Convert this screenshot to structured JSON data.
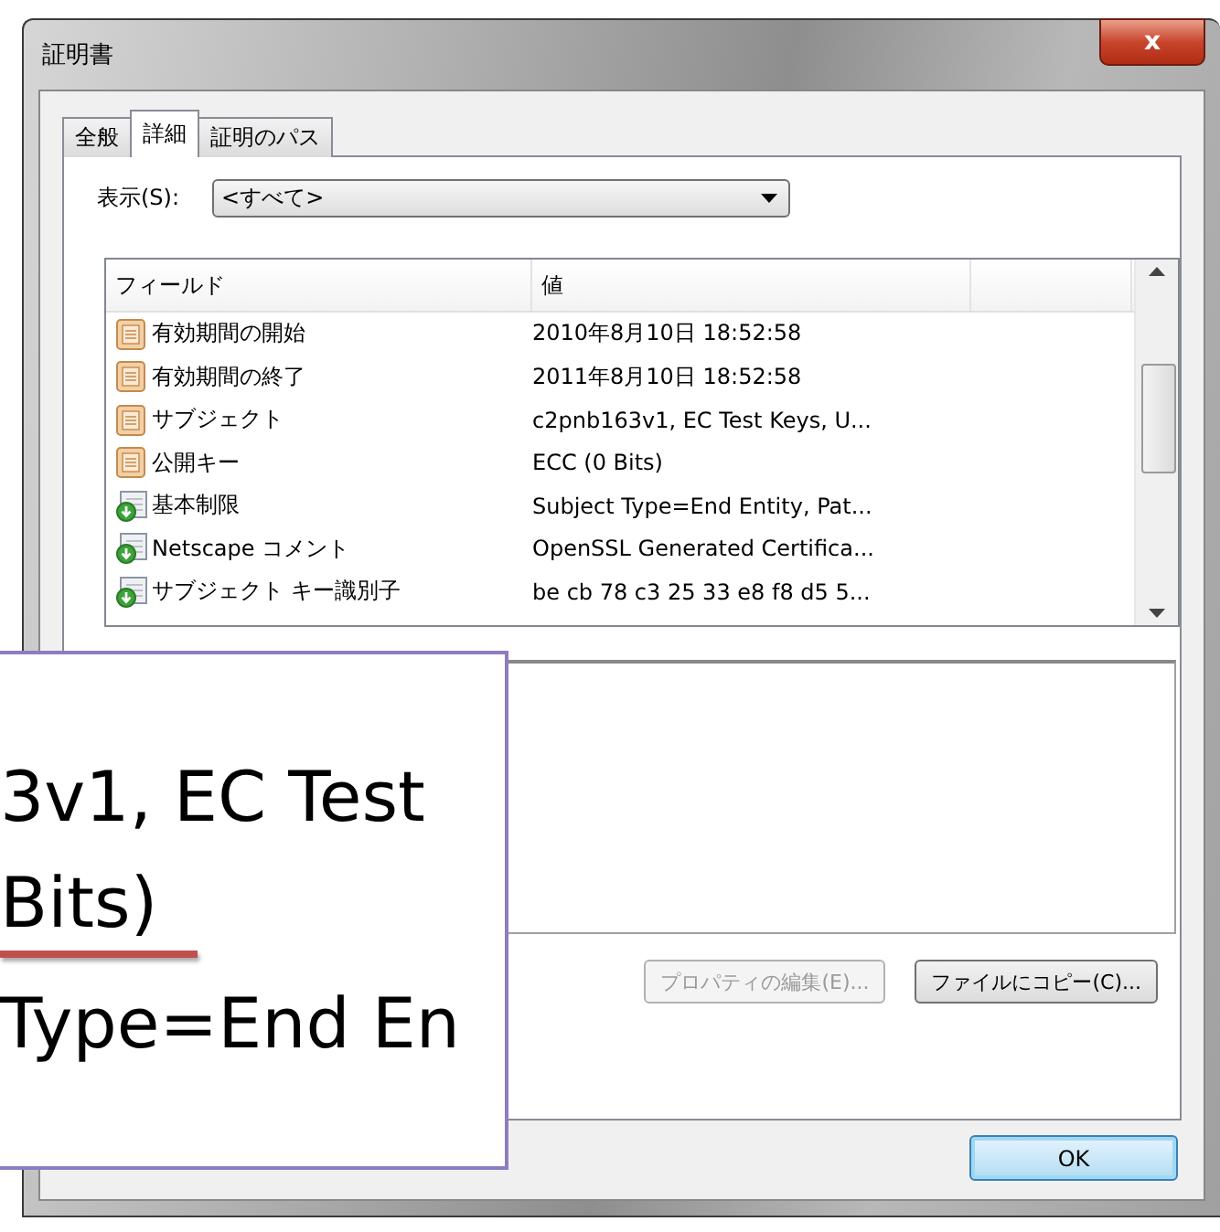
{
  "window": {
    "title": "証明書",
    "close": "x"
  },
  "tabs": [
    {
      "label": "全般",
      "selected": false
    },
    {
      "label": "詳細",
      "selected": true
    },
    {
      "label": "証明のパス",
      "selected": false
    }
  ],
  "show": {
    "label": "表示(S):",
    "value": "<すべて>"
  },
  "list": {
    "columns": [
      "フィールド",
      "値"
    ],
    "rows": [
      {
        "kind": "property",
        "field": "有効期間の開始",
        "value": "2010年8月10日 18:52:58",
        "selected": false
      },
      {
        "kind": "property",
        "field": "有効期間の終了",
        "value": "2011年8月10日 18:52:58",
        "selected": false
      },
      {
        "kind": "property",
        "field": "サブジェクト",
        "value": "c2pnb163v1, EC Test Keys, U...",
        "selected": false
      },
      {
        "kind": "property",
        "field": "公開キー",
        "value": "ECC (0 Bits)",
        "selected": false
      },
      {
        "kind": "extension",
        "field": "基本制限",
        "value": "Subject Type=End Entity, Pat...",
        "selected": false
      },
      {
        "kind": "extension",
        "field": "Netscape コメント",
        "value": "OpenSSL Generated Certifica...",
        "selected": false
      },
      {
        "kind": "extension",
        "field": "サブジェクト キー識別子",
        "value": "be cb 78 c3 25 33 e8 f8 d5 5...",
        "selected": false
      }
    ]
  },
  "buttons": [
    {
      "label": "プロパティの編集(E)...",
      "disabled": true
    },
    {
      "label": "ファイルにコピー(C)...",
      "disabled": false
    }
  ],
  "ok": "OK",
  "magnifier": {
    "lines": [
      {
        "text": "3v1, EC Test",
        "underlined": false
      },
      {
        "text": "Bits)",
        "underlined": true
      },
      {
        "text": "Type=End En",
        "underlined": false
      }
    ]
  }
}
